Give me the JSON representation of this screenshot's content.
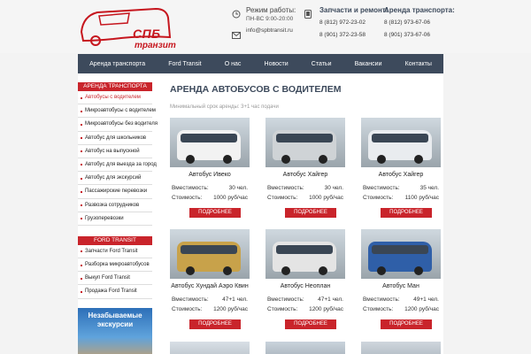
{
  "header": {
    "logo_main": "СПБ",
    "logo_sub": "транзит",
    "hours_title": "Режим работы:",
    "hours_value": "ПН-ВС 9:00-20:00",
    "email": "info@spbtransit.ru",
    "parts_title": "Запчасти и ремонт:",
    "parts_phone1": "8 (812) 972-23-02",
    "parts_phone2": "8 (901) 372-23-58",
    "rent_title": "Аренда транспорта:",
    "rent_phone1": "8 (812) 973-67-06",
    "rent_phone2": "8 (901) 373-67-06"
  },
  "nav": [
    "Аренда транспорта",
    "Ford Transit",
    "О нас",
    "Новости",
    "Статьи",
    "Вакансии",
    "Контакты"
  ],
  "sidebar": {
    "section1_title": "Аренда транспорта",
    "section1_items": [
      "Автобусы с водителем",
      "Микроавтобусы с водителем",
      "Микроавтобусы без водителя",
      "Автобус для школьников",
      "Автобус на выпускной",
      "Автобус для выезда за город",
      "Автобус для экскурсий",
      "Пассажирские перевозки",
      "Развозка сотрудников",
      "Грузоперевозки"
    ],
    "section2_title": "Ford Transit",
    "section2_items": [
      "Запчасти Ford Transit",
      "Разборка микроавтобусов",
      "Выкуп Ford Transit",
      "Продажа Ford Transit"
    ],
    "promo_text": "Незабываемые экскурсии"
  },
  "main": {
    "title": "АРЕНДА АВТОБУСОВ С ВОДИТЕЛЕМ",
    "subtitle": "Минимальный срок аренды: 3+1 час подачи",
    "capacity_label": "Вместимость:",
    "cost_label": "Стоимость:",
    "button_label": "ПОДРОБНЕЕ",
    "cards": [
      {
        "name": "Автобус Ивеко",
        "capacity": "30 чел.",
        "cost": "1000 руб/час",
        "color": "#f2f2f2"
      },
      {
        "name": "Автобус Хайгер",
        "capacity": "30 чел.",
        "cost": "1000 руб/час",
        "color": "#cfd3d6"
      },
      {
        "name": "Автобус Хайгер",
        "capacity": "35 чел.",
        "cost": "1100 руб/час",
        "color": "#e9ecef"
      },
      {
        "name": "Автобус Хундай Аэро Квин",
        "capacity": "47+1 чел.",
        "cost": "1200 руб/час",
        "color": "#c8a24a"
      },
      {
        "name": "Автобус Неоплан",
        "capacity": "47+1 чел.",
        "cost": "1200 руб/час",
        "color": "#e4e4e4"
      },
      {
        "name": "Автобус Ман",
        "capacity": "49+1 чел.",
        "cost": "1200 руб/час",
        "color": "#2f5fa8"
      }
    ]
  }
}
